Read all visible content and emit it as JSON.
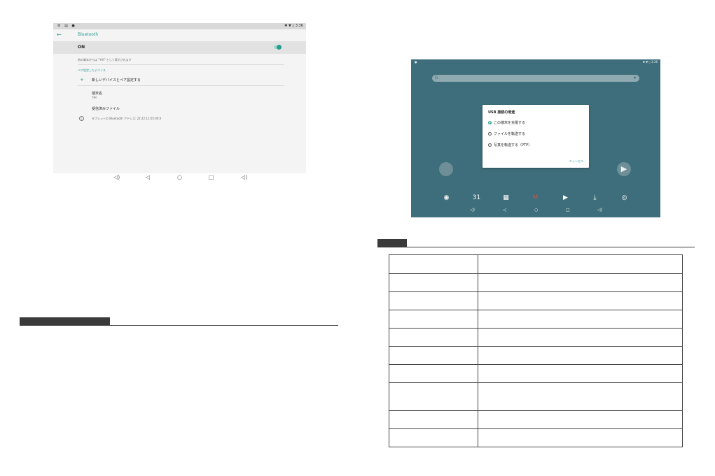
{
  "bluetooth_screenshot": {
    "status_bar": {
      "left_icons": "⚙ ▤ ●",
      "right": "✱ ▼ ▯ 3:36"
    },
    "back_icon": "arrow-left-icon",
    "title": "Bluetooth",
    "toggle_label": "ON",
    "toggle_on": true,
    "visibility_note": "他の端末からは \"YHI\" として表示されます",
    "paired_header": "ペア設定したデバイス",
    "pair_new": "新しいデバイスとペア設定する",
    "device_name_label": "端末名",
    "device_name_value": "YHI",
    "received_files": "受信済みファイル",
    "address_note": "タブレットの Bluetooth アドレス: 22:22:11:05:00:0"
  },
  "bluetooth_nav": [
    {
      "name": "volume-down-icon",
      "glyph": "◁)"
    },
    {
      "name": "back-icon",
      "glyph": "◁"
    },
    {
      "name": "home-icon",
      "glyph": "○"
    },
    {
      "name": "recents-icon",
      "glyph": "□"
    },
    {
      "name": "volume-up-icon",
      "glyph": "◁)"
    }
  ],
  "home_screenshot": {
    "status_bar": {
      "left": "●",
      "right": "✱ ▼ ▯ 3:36"
    },
    "search_icon": "google-g-icon",
    "mic_icon": "mic-icon",
    "usb_dialog": {
      "title": "USB 接続の用途",
      "options": [
        {
          "label": "この端末を充電する",
          "selected": true
        },
        {
          "label": "ファイルを転送する",
          "selected": false
        },
        {
          "label": "写真を転送する（PTP）",
          "selected": false
        }
      ],
      "cancel": "キャンセル"
    },
    "dock": [
      {
        "name": "chrome-icon",
        "glyph": "◉",
        "color": "#d94b3b"
      },
      {
        "name": "calendar-icon",
        "glyph": "31",
        "color": "#5f7e8c"
      },
      {
        "name": "photos-icon",
        "glyph": "▦",
        "color": "#5f7e8c"
      },
      {
        "name": "gmail-icon",
        "glyph": "M",
        "color": "#d8d8d8"
      },
      {
        "name": "duo-icon",
        "glyph": "▶",
        "color": "#1a5fc9"
      },
      {
        "name": "files-icon",
        "glyph": "⤓",
        "color": "#5f7e8c"
      },
      {
        "name": "camera-icon",
        "glyph": "◎",
        "color": "#2f6fb8"
      }
    ],
    "nav": [
      {
        "name": "volume-down-icon",
        "glyph": "◁)"
      },
      {
        "name": "back-icon",
        "glyph": "◁"
      },
      {
        "name": "home-icon",
        "glyph": "○"
      },
      {
        "name": "recents-icon",
        "glyph": "□"
      },
      {
        "name": "volume-up-icon",
        "glyph": "◁)"
      }
    ]
  },
  "spec_table": {
    "rows": [
      [
        "",
        ""
      ],
      [
        "",
        ""
      ],
      [
        "",
        ""
      ],
      [
        "",
        ""
      ],
      [
        "",
        ""
      ],
      [
        "",
        ""
      ],
      [
        "",
        ""
      ],
      [
        "",
        ""
      ],
      [
        "",
        ""
      ],
      [
        "",
        ""
      ]
    ]
  },
  "colors": {
    "accent": "#2a9d8f",
    "home_bg": "#3e6e7b",
    "header_tab": "#3a3a3a"
  }
}
